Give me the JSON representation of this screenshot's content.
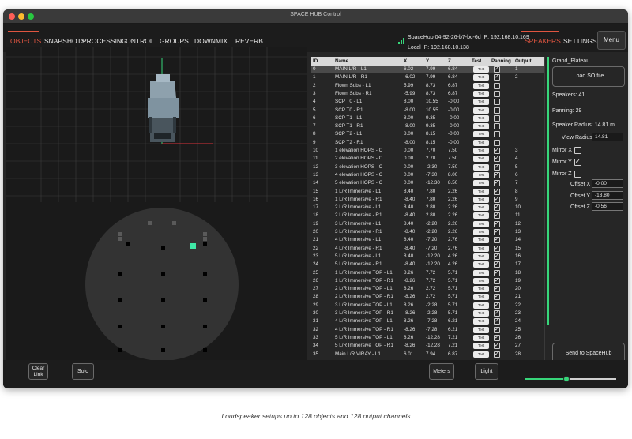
{
  "window": {
    "title": "SPACE HUB Control",
    "traffic_lights": [
      "#ff5f57",
      "#febc2e",
      "#28c840"
    ]
  },
  "menu": {
    "items": [
      "OBJECTS",
      "SNAPSHOTS",
      "PROCESSING",
      "CONTROL",
      "GROUPS",
      "DOWNMIX",
      "REVERB"
    ],
    "active": "OBJECTS",
    "right_items": [
      "SPEAKERS",
      "SETTINGS"
    ],
    "right_active": "SPEAKERS",
    "menu_button": "Menu",
    "accent_color": "#e05540"
  },
  "hub": {
    "info_line1": "SpaceHub 04-92-26-b7-bc-6d IP: 192.168.10.169",
    "info_line2": "Local IP: 192.168.10.138",
    "icon": "network-status-icon"
  },
  "speakers_table": {
    "headers": [
      "ID",
      "Name",
      "X",
      "Y",
      "Z",
      "Test",
      "Panning",
      "Output"
    ],
    "test_label": "Test",
    "rows": [
      {
        "id": "0",
        "name": "MAIN L/R - L1",
        "x": "6.02",
        "y": "7.99",
        "z": "6.84",
        "pan": true,
        "out": "1"
      },
      {
        "id": "1",
        "name": "MAIN L/R - R1",
        "x": "-6.02",
        "y": "7.99",
        "z": "6.84",
        "pan": true,
        "out": "2"
      },
      {
        "id": "2",
        "name": "Flown Subs - L1",
        "x": "5.99",
        "y": "8.73",
        "z": "6.87",
        "pan": false,
        "out": ""
      },
      {
        "id": "3",
        "name": "Flown Subs - R1",
        "x": "-5.99",
        "y": "8.73",
        "z": "6.87",
        "pan": false,
        "out": ""
      },
      {
        "id": "4",
        "name": "SCP T0 - L1",
        "x": "8.00",
        "y": "10.55",
        "z": "-0.00",
        "pan": false,
        "out": ""
      },
      {
        "id": "5",
        "name": "SCP T0 - R1",
        "x": "-8.00",
        "y": "10.55",
        "z": "-0.00",
        "pan": false,
        "out": ""
      },
      {
        "id": "6",
        "name": "SCP T1 - L1",
        "x": "8.00",
        "y": "9.35",
        "z": "-0.00",
        "pan": false,
        "out": ""
      },
      {
        "id": "7",
        "name": "SCP T1 - R1",
        "x": "-8.00",
        "y": "9.35",
        "z": "-0.00",
        "pan": false,
        "out": ""
      },
      {
        "id": "8",
        "name": "SCP T2 - L1",
        "x": "8.00",
        "y": "8.15",
        "z": "-0.00",
        "pan": false,
        "out": ""
      },
      {
        "id": "9",
        "name": "SCP T2 - R1",
        "x": "-8.00",
        "y": "8.15",
        "z": "-0.00",
        "pan": false,
        "out": ""
      },
      {
        "id": "10",
        "name": "1 elevation HOPS - C",
        "x": "0.00",
        "y": "7.70",
        "z": "7.50",
        "pan": true,
        "out": "3"
      },
      {
        "id": "11",
        "name": "2 elevation HOPS - C",
        "x": "0.00",
        "y": "2.70",
        "z": "7.50",
        "pan": true,
        "out": "4"
      },
      {
        "id": "12",
        "name": "3 elevation HOPS - C",
        "x": "0.00",
        "y": "-2.30",
        "z": "7.50",
        "pan": true,
        "out": "5"
      },
      {
        "id": "13",
        "name": "4 elevation HOPS - C",
        "x": "0.00",
        "y": "-7.30",
        "z": "8.00",
        "pan": true,
        "out": "6"
      },
      {
        "id": "14",
        "name": "5 elevation HOPS - C",
        "x": "0.00",
        "y": "-12.30",
        "z": "8.50",
        "pan": true,
        "out": "7"
      },
      {
        "id": "15",
        "name": "1 L/R Immersive - L1",
        "x": "8.40",
        "y": "7.80",
        "z": "2.26",
        "pan": true,
        "out": "8"
      },
      {
        "id": "16",
        "name": "1 L/R Immersive - R1",
        "x": "-8.40",
        "y": "7.80",
        "z": "2.26",
        "pan": true,
        "out": "9"
      },
      {
        "id": "17",
        "name": "2 L/R Immersive - L1",
        "x": "8.40",
        "y": "2.80",
        "z": "2.26",
        "pan": true,
        "out": "10"
      },
      {
        "id": "18",
        "name": "2 L/R Immersive - R1",
        "x": "-8.40",
        "y": "2.80",
        "z": "2.26",
        "pan": true,
        "out": "11"
      },
      {
        "id": "19",
        "name": "3 L/R Immersive - L1",
        "x": "8.40",
        "y": "-2.20",
        "z": "2.26",
        "pan": true,
        "out": "12"
      },
      {
        "id": "20",
        "name": "3 L/R Immersive - R1",
        "x": "-8.40",
        "y": "-2.20",
        "z": "2.26",
        "pan": true,
        "out": "13"
      },
      {
        "id": "21",
        "name": "4 L/R Immersive - L1",
        "x": "8.40",
        "y": "-7.20",
        "z": "2.76",
        "pan": true,
        "out": "14"
      },
      {
        "id": "22",
        "name": "4 L/R Immersive - R1",
        "x": "-8.40",
        "y": "-7.20",
        "z": "2.76",
        "pan": true,
        "out": "15"
      },
      {
        "id": "23",
        "name": "5 L/R Immersive - L1",
        "x": "8.40",
        "y": "-12.20",
        "z": "4.26",
        "pan": true,
        "out": "16"
      },
      {
        "id": "24",
        "name": "5 L/R Immersive - R1",
        "x": "-8.40",
        "y": "-12.20",
        "z": "4.26",
        "pan": true,
        "out": "17"
      },
      {
        "id": "25",
        "name": "1 L/R Immersive TOP - L1",
        "x": "8.26",
        "y": "7.72",
        "z": "5.71",
        "pan": true,
        "out": "18"
      },
      {
        "id": "26",
        "name": "1 L/R Immersive TOP - R1",
        "x": "-8.26",
        "y": "7.72",
        "z": "5.71",
        "pan": true,
        "out": "19"
      },
      {
        "id": "27",
        "name": "2 L/R Immersive TOP - L1",
        "x": "8.26",
        "y": "2.72",
        "z": "5.71",
        "pan": true,
        "out": "20"
      },
      {
        "id": "28",
        "name": "2 L/R Immersive TOP - R1",
        "x": "-8.26",
        "y": "2.72",
        "z": "5.71",
        "pan": true,
        "out": "21"
      },
      {
        "id": "29",
        "name": "3 L/R Immersive TOP - L1",
        "x": "8.26",
        "y": "-2.28",
        "z": "5.71",
        "pan": true,
        "out": "22"
      },
      {
        "id": "30",
        "name": "3 L/R Immersive TOP - R1",
        "x": "-8.26",
        "y": "-2.28",
        "z": "5.71",
        "pan": true,
        "out": "23"
      },
      {
        "id": "31",
        "name": "4 L/R Immersive TOP - L1",
        "x": "8.26",
        "y": "-7.28",
        "z": "6.21",
        "pan": true,
        "out": "24"
      },
      {
        "id": "32",
        "name": "4 L/R Immersive TOP - R1",
        "x": "-8.26",
        "y": "-7.28",
        "z": "6.21",
        "pan": true,
        "out": "25"
      },
      {
        "id": "33",
        "name": "5 L/R Immersive TOP - L1",
        "x": "8.26",
        "y": "-12.28",
        "z": "7.21",
        "pan": true,
        "out": "26"
      },
      {
        "id": "34",
        "name": "5 L/R Immersive TOP - R1",
        "x": "-8.26",
        "y": "-12.28",
        "z": "7.21",
        "pan": true,
        "out": "27"
      },
      {
        "id": "35",
        "name": "Main L/R VIRAY - L1",
        "x": "6.01",
        "y": "7.94",
        "z": "6.87",
        "pan": true,
        "out": "28"
      }
    ]
  },
  "settings_panel": {
    "preset_name": "Grand_Plateau",
    "load_button": "Load SO file",
    "speakers_label": "Speakers: 41",
    "panning_label": "Panning: 29",
    "radius_label": "Speaker Radius: 14.81 m",
    "view_radius_label": "View Radius",
    "view_radius_value": "14.81",
    "mirror_x_label": "Mirror X",
    "mirror_x": false,
    "mirror_y_label": "Mirror Y",
    "mirror_y": true,
    "mirror_z_label": "Mirror Z",
    "mirror_z": false,
    "offset_x_label": "Offset X",
    "offset_x_value": "-0.00",
    "offset_y_label": "Offset Y",
    "offset_y_value": "-13.80",
    "offset_z_label": "Offset Z",
    "offset_z_value": "-0.56",
    "send_button": "Send to SpaceHub"
  },
  "bottom_bar": {
    "clear_link": "Clear\nLink",
    "solo": "Solo",
    "meters": "Meters",
    "light": "Light",
    "level_fraction": 0.46,
    "level_color": "#37d67a"
  },
  "caption": "Loudspeaker setups up to 128 objects and 128 output channels"
}
